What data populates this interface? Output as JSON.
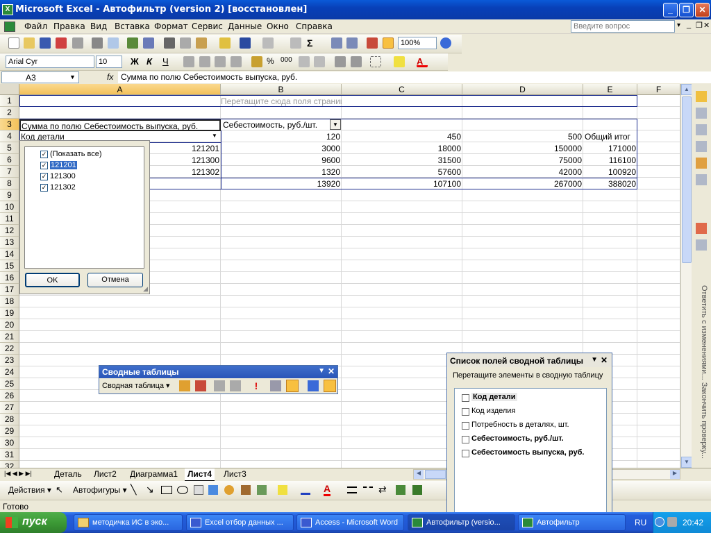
{
  "window": {
    "title": "Microsoft Excel - Автофильтр (version 2)  [восстановлен]"
  },
  "menu": {
    "items": [
      "Файл",
      "Правка",
      "Вид",
      "Вставка",
      "Формат",
      "Сервис",
      "Данные",
      "Окно",
      "Справка"
    ],
    "help_placeholder": "Введите вопрос"
  },
  "toolbar": {
    "zoom": "100%",
    "font": "Arial Cyr",
    "size": "10"
  },
  "formula_bar": {
    "cell_ref": "A3",
    "fx": "fx",
    "content": "Сумма по полю Себестоимость выпуска, руб."
  },
  "columns": [
    "A",
    "B",
    "C",
    "D",
    "E",
    "F"
  ],
  "rows": [
    "1",
    "2",
    "3",
    "4",
    "5",
    "6",
    "7",
    "8",
    "9",
    "10",
    "11",
    "12",
    "13",
    "14",
    "15",
    "16",
    "17",
    "18",
    "19",
    "20",
    "21",
    "22",
    "23",
    "24",
    "25",
    "26",
    "27",
    "28",
    "29",
    "30",
    "31",
    "32"
  ],
  "pivot": {
    "drop_pages": "Перетащите сюда поля страниц",
    "data_field": "Сумма по полю Себестоимость выпуска, руб.",
    "col_field": "Себестоимость, руб./шт.",
    "row_field": "Код  детали",
    "col_values": [
      "120",
      "450",
      "500",
      "Общий итог"
    ],
    "rows": [
      {
        "key": "121201",
        "values": [
          "3000",
          "18000",
          "150000",
          "171000"
        ]
      },
      {
        "key": "121300",
        "values": [
          "9600",
          "31500",
          "75000",
          "116100"
        ]
      },
      {
        "key": "121302",
        "values": [
          "1320",
          "57600",
          "42000",
          "100920"
        ]
      }
    ],
    "totals": [
      "13920",
      "107100",
      "267000",
      "388020"
    ]
  },
  "filter_popup": {
    "items": [
      "(Показать все)",
      "121201",
      "121300",
      "121302"
    ],
    "ok": "OK",
    "cancel": "Отмена"
  },
  "sheets": [
    "Деталь",
    "Лист2",
    "Диаграмма1",
    "Лист4",
    "Лист3"
  ],
  "active_sheet": "Лист4",
  "pivot_toolbar": {
    "title": "Сводные таблицы",
    "menu": "Сводная таблица ▾"
  },
  "field_list": {
    "title": "Список полей сводной таблицы",
    "hint": "Перетащите элементы в сводную таблицу",
    "fields": [
      {
        "name": "Код  детали",
        "bold": true
      },
      {
        "name": "Код изделия",
        "bold": false
      },
      {
        "name": "Потребность в деталях, шт.",
        "bold": false
      },
      {
        "name": "Себестоимость, руб./шт.",
        "bold": true
      },
      {
        "name": "Себестоимость выпуска, руб.",
        "bold": true
      }
    ]
  },
  "drawing": {
    "actions": "Действия ▾",
    "autoshapes": "Автофигуры ▾"
  },
  "status": "Готово",
  "taskbar": {
    "start": "пуск",
    "buttons": [
      "методичка ИС в эко...",
      "Excel отбор данных ...",
      "Access - Microsoft Word",
      "Автофильтр (versio...",
      "Автофильтр"
    ],
    "lang": "RU",
    "time": "20:42"
  },
  "taskpane_text": "Ответить с изменениями...  Закончить проверку..."
}
